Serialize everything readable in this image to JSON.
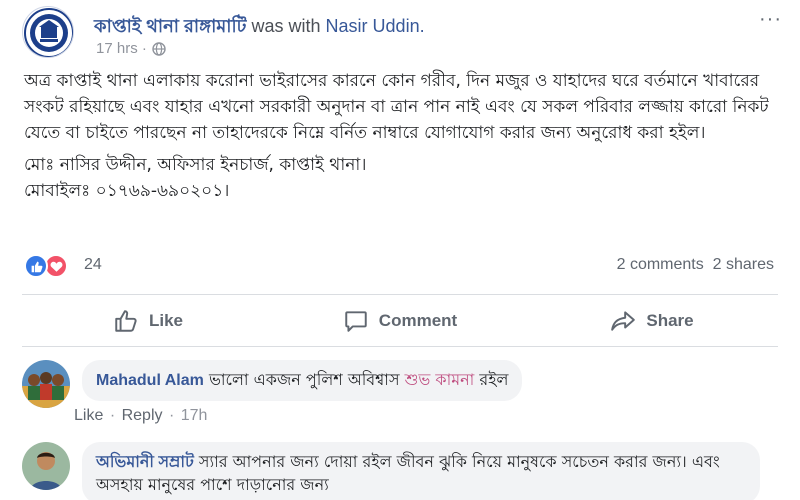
{
  "post": {
    "page_name": "কাপ্তাই থানা রাঙ্গামাটি",
    "was_with": "was with",
    "tagged_name": "Nasir Uddin.",
    "time": "17 hrs ·",
    "more": "···",
    "body_paragraph": "অত্র কাপ্তাই থানা এলাকায় করোনা ভাইরাসের কারনে কোন গরীব, দিন মজুর ও যাহাদের ঘরে বর্তমানে খাবারের সংকট রহিয়াছে এবং যাহার এখনো সরকারী অনুদান বা ত্রান পান নাই এবং যে সকল পরিবার লজ্জায় কারো নিকট যেতে বা চাইতে পারছেন না তাহাদেরকে নিম্নে বর্নিত নাম্বারে যোগাযোগ করার জন্য অনুরোধ করা হইল।",
    "signature": "মোঃ নাসির উদ্দীন, অফিসার ইনচার্জ, কাপ্তাই থানা।",
    "mobile": "মোবাইলঃ ০১৭৬৯-৬৯০২০১।"
  },
  "reactions": {
    "count": "24",
    "comments": "2 comments",
    "shares": "2 shares",
    "icons": [
      "like-icon",
      "love-icon"
    ]
  },
  "actions": {
    "like": "Like",
    "comment": "Comment",
    "share": "Share"
  },
  "comments": [
    {
      "author": "Mahadul Alam",
      "text_before": "ভালো একজন পুলিশ অবিশ্বাস",
      "text_highlight": "শুভ কামনা",
      "text_after": "রইল",
      "like": "Like",
      "reply": "Reply",
      "time": "17h"
    },
    {
      "author": "অভিমানী সম্রাট",
      "text": "স্যার আপনার জন্য দোয়া রইল জীবন ঝুকি নিয়ে মানুষকে সচেতন করার জন্য। এবং অসহায় মানুষের পাশে দাড়ানোর জন্য"
    }
  ],
  "colors": {
    "link": "#385898",
    "muted": "#606770",
    "like_blue": "#3578e5",
    "love_red": "#f25268",
    "highlight": "#be4b7e"
  }
}
